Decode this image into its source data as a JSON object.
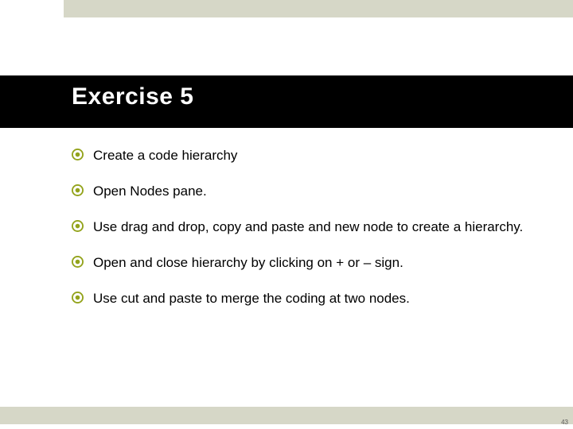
{
  "slide": {
    "title": "Exercise 5",
    "bullets": [
      "Create a code hierarchy",
      "Open Nodes pane.",
      "Use drag and drop, copy and paste and new node to create a hierarchy.",
      "Open and close hierarchy by clicking on + or – sign.",
      "Use cut and paste to merge the coding at two nodes."
    ],
    "page_number": "43"
  },
  "colors": {
    "accent_bar": "#d6d7c7",
    "title_band": "#000000",
    "bullet": "#93a31b"
  }
}
